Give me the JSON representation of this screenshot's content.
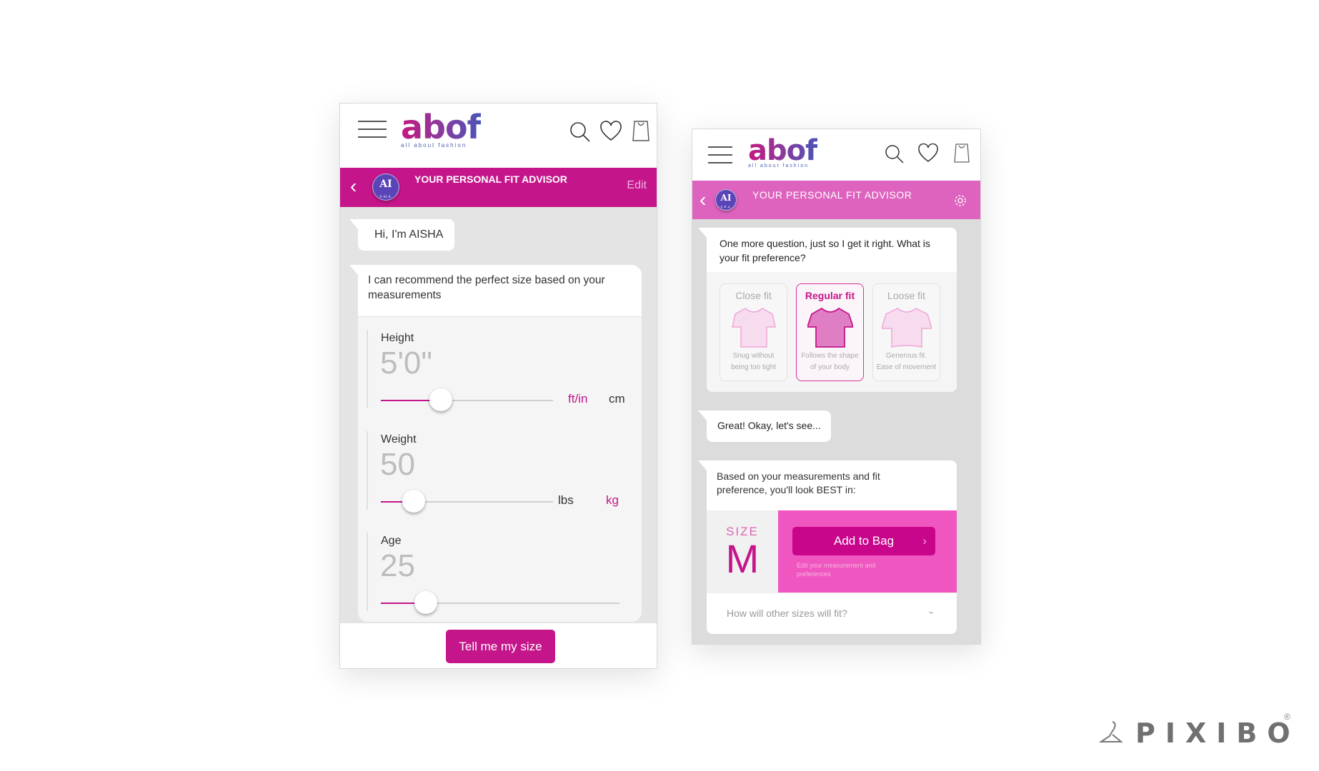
{
  "brand": {
    "logo": "abof",
    "tagline": "all about fashion",
    "accent": "#c4168a",
    "accent_light": "#de63be"
  },
  "header_icons": [
    "menu-icon",
    "search-icon",
    "heart-icon",
    "bag-icon"
  ],
  "left": {
    "advisor_title": "YOUR PERSONAL FIT ADVISOR",
    "advisor_action": "Edit",
    "avatar_text": "AI",
    "avatar_sub": "SHA",
    "greeting": "Hi, I'm AISHA",
    "intro": "I can recommend the perfect size based on your measurements",
    "fields": [
      {
        "label": "Height",
        "value": "5'0\"",
        "slider_fraction": 0.35,
        "units": [
          "ft/in",
          "cm"
        ],
        "active_unit": "ft/in"
      },
      {
        "label": "Weight",
        "value": "50",
        "slider_fraction": 0.19,
        "units": [
          "lbs",
          "kg"
        ],
        "active_unit": "kg"
      },
      {
        "label": "Age",
        "value": "25",
        "slider_fraction": 0.19,
        "units": [],
        "active_unit": null
      }
    ],
    "cta": "Tell me my size"
  },
  "right": {
    "advisor_title": "YOUR PERSONAL FIT ADVISOR",
    "avatar_text": "AI",
    "avatar_sub": "SHA",
    "question": "One more question, just so I get it right. What is your fit preference?",
    "fit_options": [
      {
        "title": "Close fit",
        "desc1": "Snug without",
        "desc2": "being too tight",
        "selected": false
      },
      {
        "title": "Regular fit",
        "desc1": "Follows the shape",
        "desc2": "of your body",
        "selected": true
      },
      {
        "title": "Loose fit",
        "desc1": "Generous fit.",
        "desc2": "Ease of movement",
        "selected": false
      }
    ],
    "reply": "Great! Okay, let's see...",
    "result_text": "Based on your measurements and fit preference, you'll look BEST in:",
    "size_label": "SIZE",
    "size_value": "M",
    "add_to_bag": "Add to Bag",
    "edit_link": "Edit your measurement and preferences",
    "other_sizes": "How will other sizes will fit?"
  },
  "watermark": {
    "text": "PIXIBO",
    "reg": "®"
  }
}
